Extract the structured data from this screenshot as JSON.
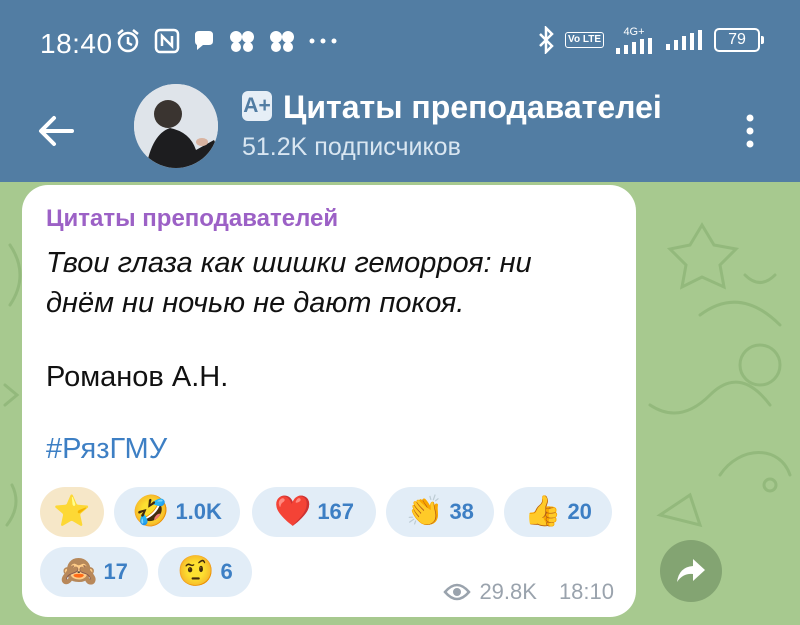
{
  "status_bar": {
    "time": "18:40",
    "network_label": "4G+",
    "volte_label": "Vo LTE",
    "battery": "79"
  },
  "header": {
    "channel_title": "Цитаты преподавателеі",
    "channel_badge": "A+",
    "subscribers": "51.2K подписчиков"
  },
  "message": {
    "author": "Цитаты преподавателей",
    "quote_line1": "Твои глаза как шишки геморроя: ни",
    "quote_line2": "днём ни ночью не дают покоя.",
    "signature": "Романов А.Н.",
    "hashtag": "#РязГМУ",
    "views": "29.8K",
    "time": "18:10"
  },
  "reactions": [
    {
      "emoji": "⭐",
      "count": "",
      "name": "star"
    },
    {
      "emoji": "🤣",
      "count": "1.0K",
      "name": "rofl"
    },
    {
      "emoji": "❤️",
      "count": "167",
      "name": "heart"
    },
    {
      "emoji": "👏",
      "count": "38",
      "name": "clap"
    },
    {
      "emoji": "👍",
      "count": "20",
      "name": "thumbs-up"
    },
    {
      "emoji": "🙈",
      "count": "17",
      "name": "see-no-evil"
    },
    {
      "emoji": "🤨",
      "count": "6",
      "name": "raised-eyebrow"
    }
  ],
  "colors": {
    "header_bg": "#527da3",
    "chat_bg": "#a7c98f",
    "author": "#9c61c6",
    "link": "#3d7fc4"
  }
}
